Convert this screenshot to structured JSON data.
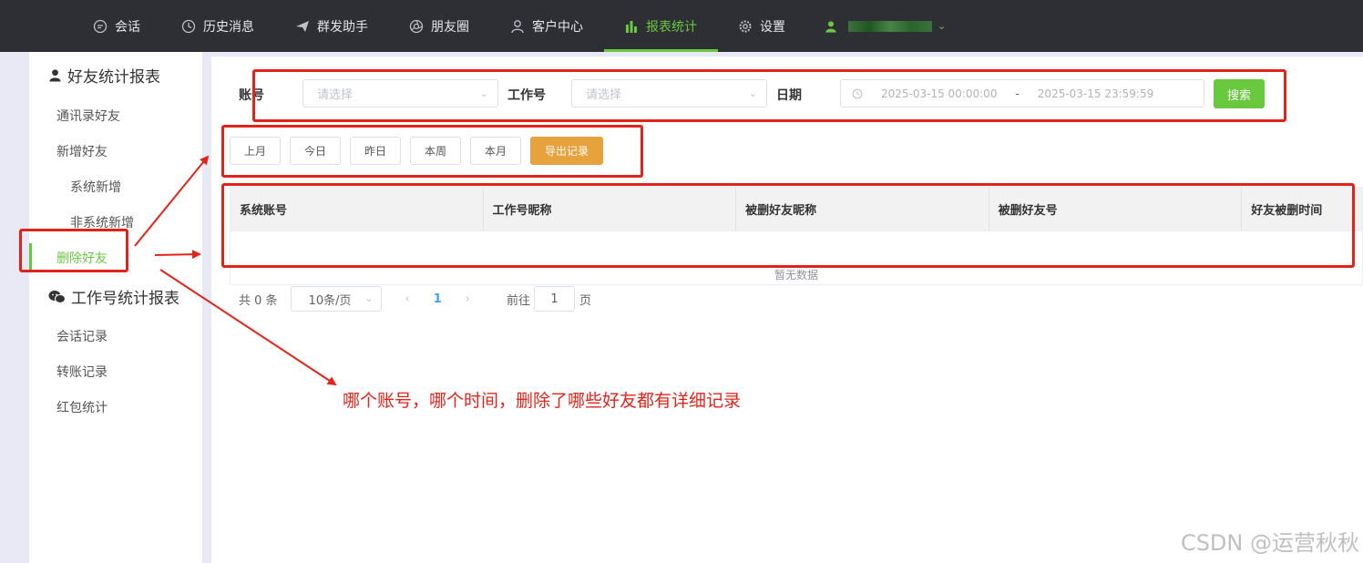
{
  "nav": {
    "items": [
      {
        "label": "会话",
        "icon": "chat-bubble-icon"
      },
      {
        "label": "历史消息",
        "icon": "clock-icon"
      },
      {
        "label": "群发助手",
        "icon": "paper-plane-icon"
      },
      {
        "label": "朋友圈",
        "icon": "aperture-icon"
      },
      {
        "label": "客户中心",
        "icon": "user-outline-icon"
      },
      {
        "label": "报表统计",
        "icon": "bar-chart-icon",
        "active": true
      },
      {
        "label": "设置",
        "icon": "gear-icon"
      }
    ],
    "user_icon": "user-filled-icon"
  },
  "sidebar": {
    "section1_title": "好友统计报表",
    "section1_items": [
      "通讯录好友",
      "新增好友",
      "系统新增",
      "非系统新增",
      "删除好友"
    ],
    "section2_title": "工作号统计报表",
    "section2_items": [
      "会话记录",
      "转账记录",
      "红包统计"
    ]
  },
  "filters": {
    "account_label": "账号",
    "account_placeholder": "请选择",
    "workno_label": "工作号",
    "workno_placeholder": "请选择",
    "date_label": "日期",
    "date_start": "2025-03-15 00:00:00",
    "date_sep": "-",
    "date_end": "2025-03-15 23:59:59",
    "search_label": "搜索"
  },
  "quick": {
    "last_month": "上月",
    "today": "今日",
    "yesterday": "昨日",
    "this_week": "本周",
    "this_month": "本月",
    "export": "导出记录"
  },
  "table": {
    "columns": [
      "系统账号",
      "工作号昵称",
      "被删好友昵称",
      "被删好友号",
      "好友被删时间"
    ],
    "empty_text": "暂无数据"
  },
  "pagination": {
    "total": "共 0 条",
    "page_size": "10条/页",
    "current_page": "1",
    "goto_label": "前往",
    "goto_value": "1",
    "unit": "页"
  },
  "annotation": {
    "text": "哪个账号，哪个时间，删除了哪些好友都有详细记录",
    "color": "#e2231a"
  },
  "watermark": "CSDN @运营秋秋",
  "colors": {
    "nav_bg": "#2d2f35",
    "accent": "#6ac83f",
    "export_btn": "#e6a23c",
    "link": "#409eff"
  }
}
